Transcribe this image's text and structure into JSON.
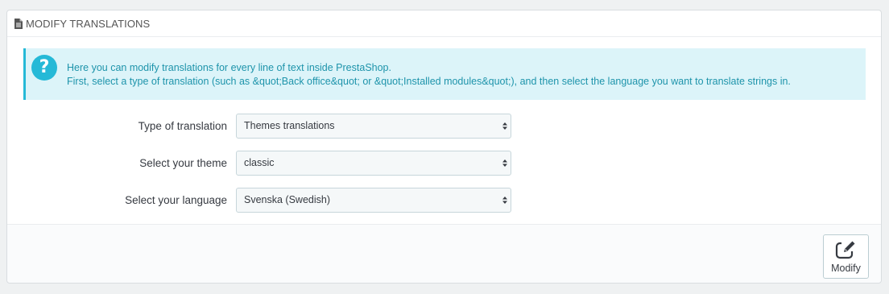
{
  "panel": {
    "heading": {
      "icon": "document-icon",
      "title": "MODIFY TRANSLATIONS"
    },
    "alert": {
      "icon": "question-icon",
      "icon_glyph": "?",
      "line1": "Here you can modify translations for every line of text inside PrestaShop.",
      "line2": "First, select a type of translation (such as &quot;Back office&quot; or &quot;Installed modules&quot;), and then select the language you want to translate strings in."
    },
    "form": {
      "type_of_translation": {
        "label": "Type of translation",
        "value": "Themes translations"
      },
      "theme": {
        "label": "Select your theme",
        "value": "classic"
      },
      "language": {
        "label": "Select your language",
        "value": "Svenska (Swedish)"
      }
    },
    "footer": {
      "modify_button": {
        "icon": "edit-icon",
        "label": "Modify"
      }
    }
  },
  "colors": {
    "accent": "#25b9d7",
    "alert_bg": "#dcf4f9",
    "alert_text": "#1e94ab",
    "text": "#363a41"
  }
}
